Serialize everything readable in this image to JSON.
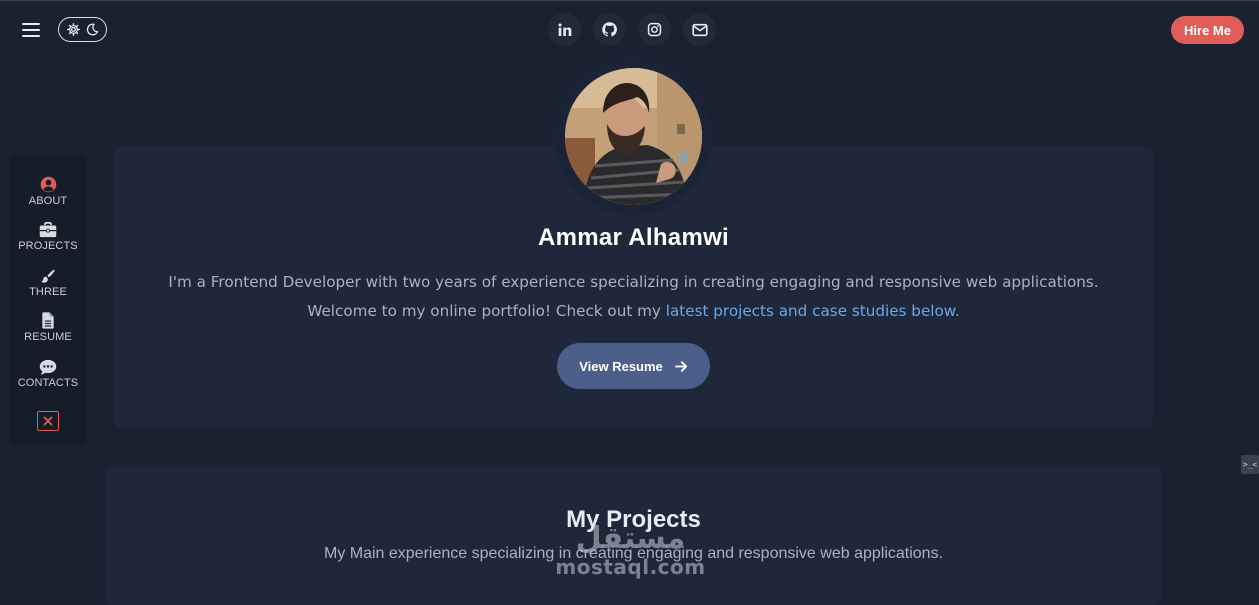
{
  "header": {
    "menu_icon": "hamburger-menu-icon",
    "theme_toggle": {
      "icons": [
        "gear-icon",
        "moon-icon"
      ]
    },
    "socials": [
      {
        "name": "linkedin",
        "icon": "linkedin-icon"
      },
      {
        "name": "github",
        "icon": "github-icon"
      },
      {
        "name": "instagram",
        "icon": "instagram-icon"
      },
      {
        "name": "email",
        "icon": "envelope-icon"
      }
    ],
    "hire_label": "Hire Me"
  },
  "sidebar": {
    "items": [
      {
        "label": "ABOUT",
        "icon": "user-circle-icon",
        "active": true
      },
      {
        "label": "PROJECTS",
        "icon": "briefcase-icon",
        "active": false
      },
      {
        "label": "THREE",
        "icon": "paintbrush-icon",
        "active": false
      },
      {
        "label": "RESUME",
        "icon": "document-icon",
        "active": false
      },
      {
        "label": "CONTACTS",
        "icon": "chat-bubble-icon",
        "active": false
      }
    ],
    "close_icon": "close-icon"
  },
  "hero": {
    "name": "Ammar Alhamwi",
    "bio_line1": "I'm a Frontend Developer with two years of experience specializing in creating engaging and responsive web applications.",
    "bio_line2_prefix": "Welcome to my online portfolio! Check out my ",
    "bio_line2_link": "latest projects and case studies below.",
    "button_label": "View Resume",
    "button_icon": "arrow-right-icon"
  },
  "projects": {
    "title": "My Projects",
    "subtitle": "My Main experience specializing in creating engaging and responsive web applications."
  },
  "watermark": {
    "arabic": "مستقل",
    "latin": "mostaql.com"
  },
  "edge_tab": {
    "label": ">_<"
  },
  "colors": {
    "background": "#1a2130",
    "card": "#1f283a",
    "accent": "#e15d57",
    "button": "#4c5f8b",
    "link": "#6aa7e8"
  }
}
